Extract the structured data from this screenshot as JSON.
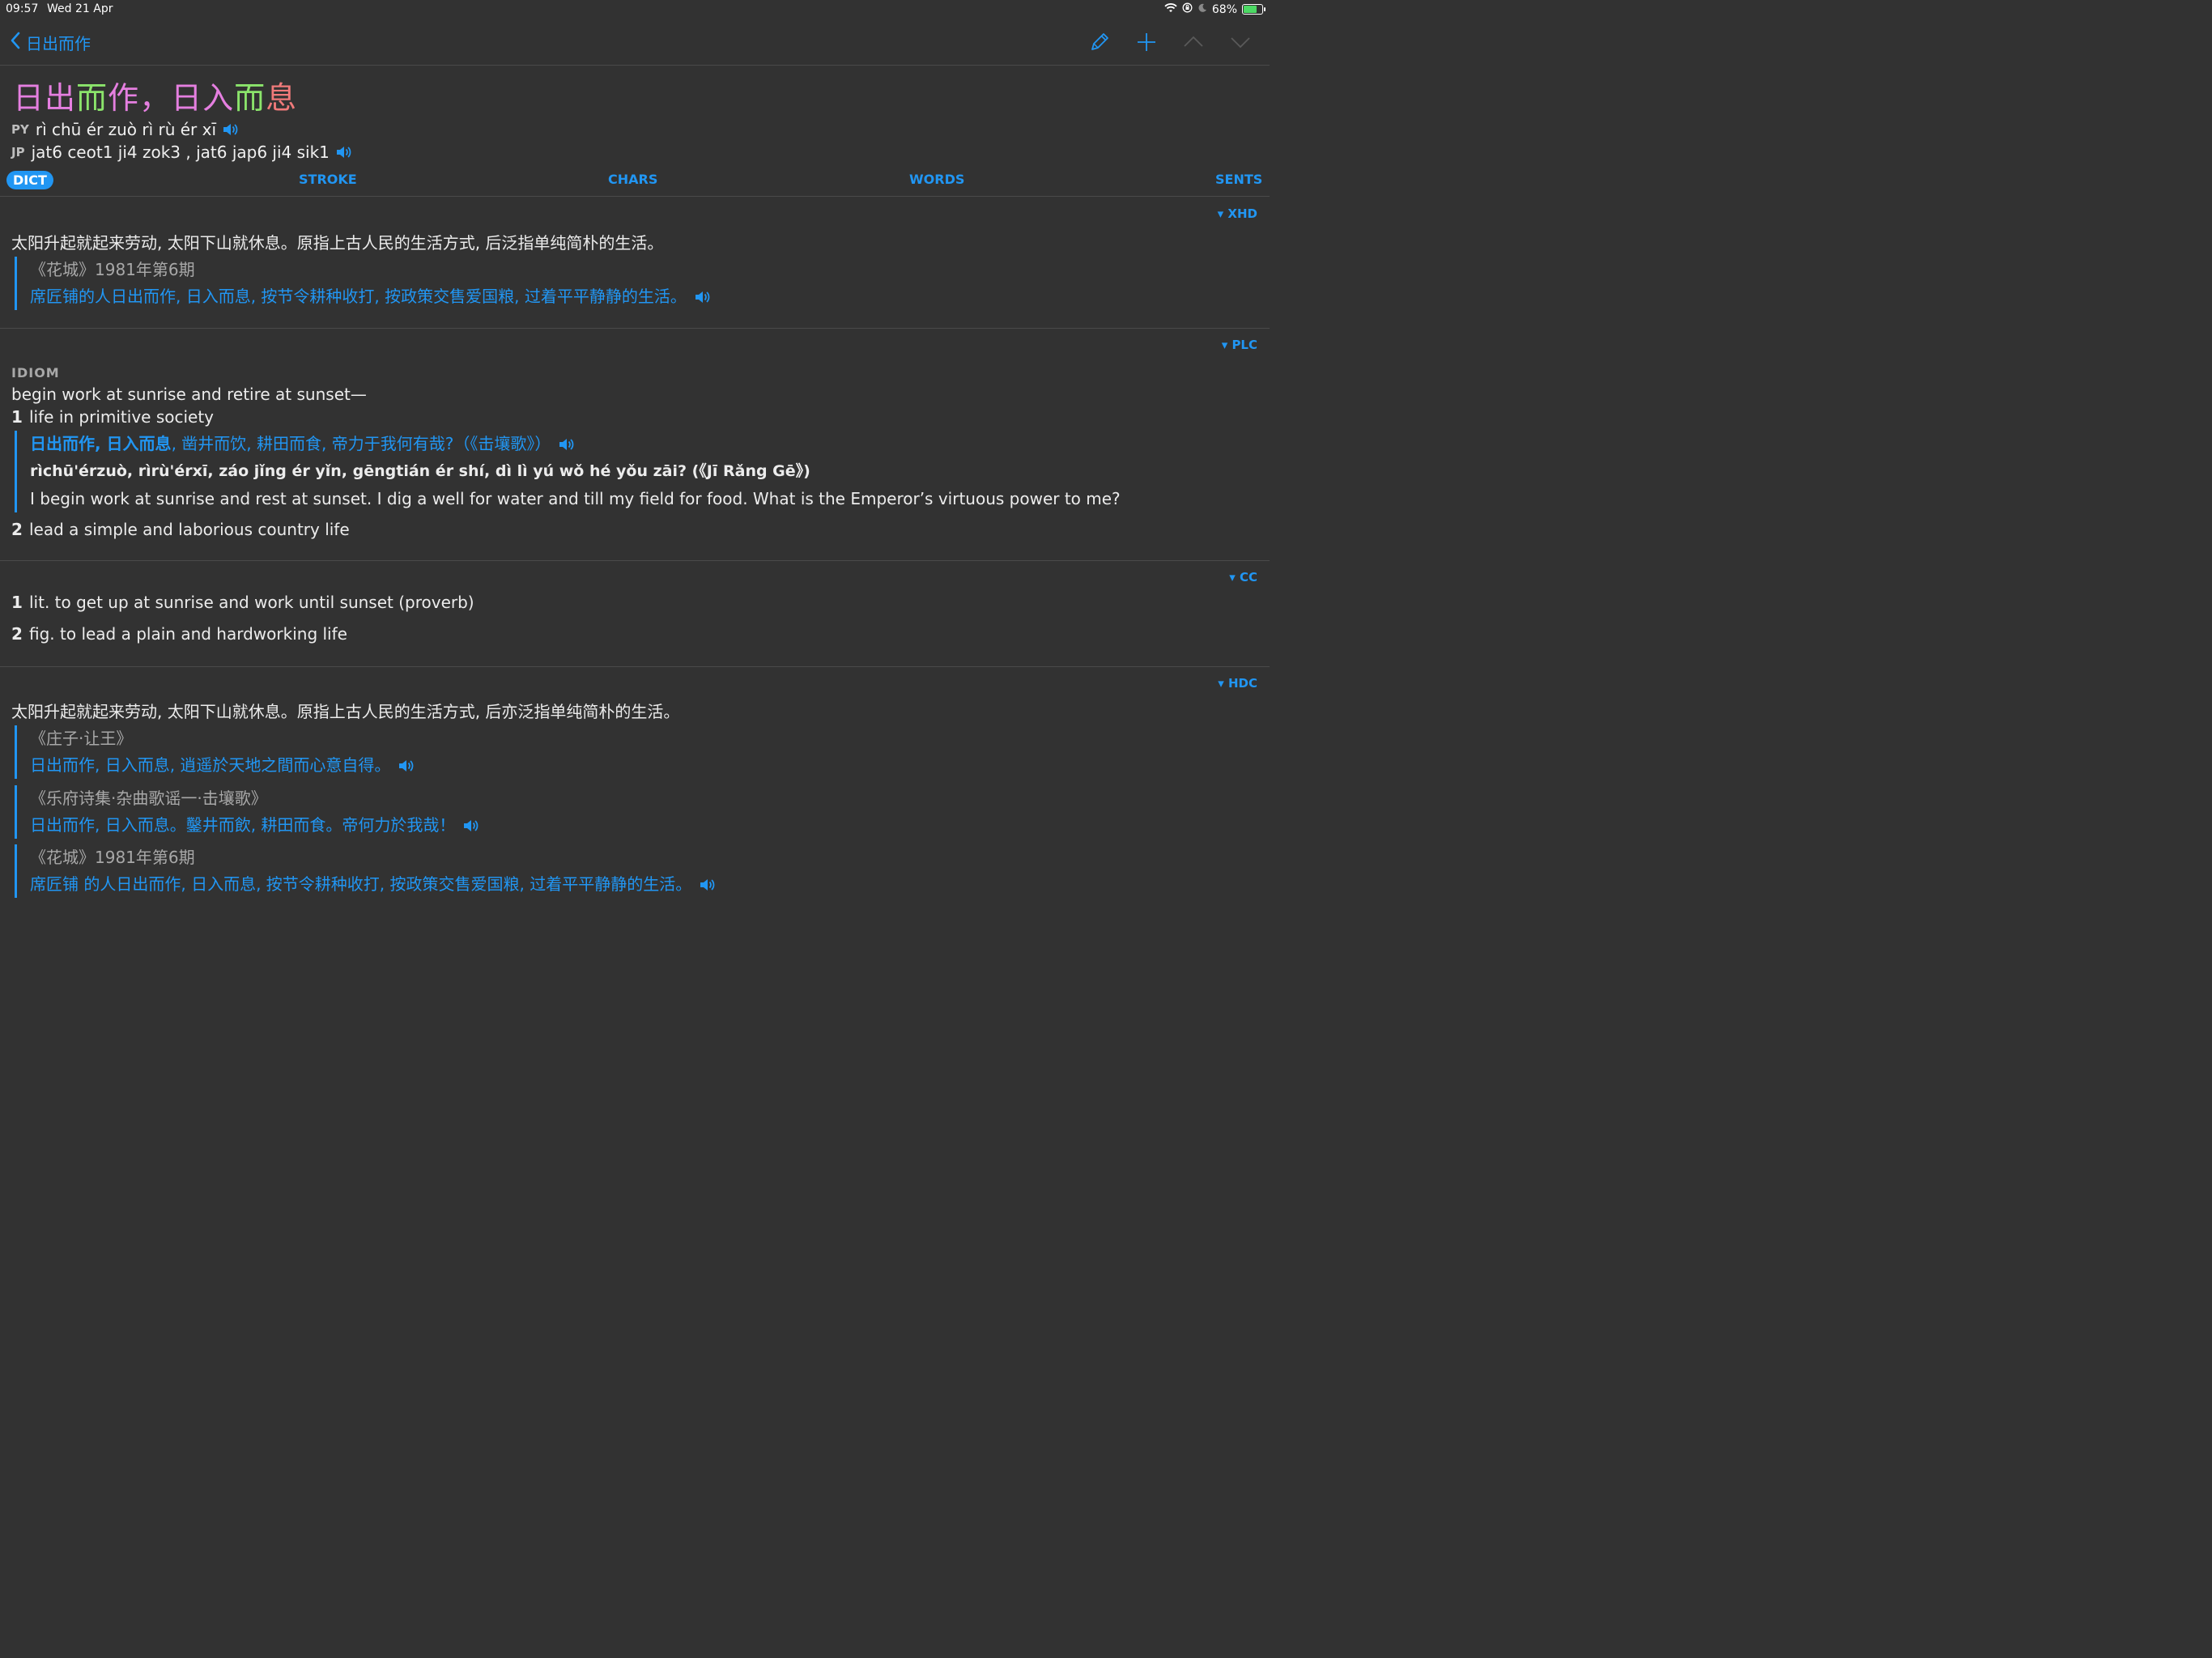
{
  "status": {
    "time": "09:57",
    "date": "Wed 21 Apr",
    "battery": "68%",
    "battery_level": 0.68
  },
  "nav": {
    "back_label": "日出而作"
  },
  "headword": {
    "chars": [
      {
        "c": "日",
        "color": "#e57fe0"
      },
      {
        "c": "出",
        "color": "#e57fe0"
      },
      {
        "c": "而",
        "color": "#8be46b"
      },
      {
        "c": "作",
        "color": "#e57fe0"
      },
      {
        "c": "，",
        "color": "#e57fe0"
      },
      {
        "c": "日",
        "color": "#e57fe0"
      },
      {
        "c": "入",
        "color": "#e57fe0"
      },
      {
        "c": "而",
        "color": "#8be46b"
      },
      {
        "c": "息",
        "color": "#f07a7a"
      }
    ]
  },
  "pron": {
    "py_tag": "PY",
    "py": "rì chū ér zuò rì rù   ér xī",
    "jp_tag": "JP",
    "jp": "jat6 ceot1 ji4 zok3 , jat6 jap6 ji4 sik1"
  },
  "tabs": [
    "DICT",
    "STROKE",
    "CHARS",
    "WORDS",
    "SENTS"
  ],
  "xhd": {
    "source": "▾ XHD",
    "definition": "太阳升起就起来劳动, 太阳下山就休息。原指上古人民的生活方式, 后泛指单纯简朴的生活。",
    "quote_source": "《花城》1981年第6期",
    "quote_text": "席匠铺的人日出而作, 日入而息, 按节令耕种收打, 按政策交售爱国粮, 过着平平静静的生活。"
  },
  "plc": {
    "source": "▾ PLC",
    "label": "IDIOM",
    "gloss": "begin work at sunrise and retire at sunset—",
    "sense1_num": "1",
    "sense1": "life in primitive society",
    "ex_bold": "日出而作, 日入而息",
    "ex_rest": ", 凿井而饮, 耕田而食, 帝力于我何有哉?（《击壤歌》）",
    "ex_pinyin": "rìchū'érzuò,  rìrù'érxī,  záo jǐng ér yǐn,  gēngtián ér shí, dì lì yú wǒ hé yǒu zāi?  (《Jī Rǎng Gē》)",
    "ex_english": "I begin work at sunrise and rest at sunset. I dig a well for water and till my field for food. What is the Emperor’s virtuous power to me?",
    "sense2_num": "2",
    "sense2": "lead a simple and laborious country life"
  },
  "cc": {
    "source": "▾ CC",
    "sense1_num": "1",
    "sense1": "lit. to get up at sunrise and work until sunset (proverb)",
    "sense2_num": "2",
    "sense2": "fig. to lead a plain and hardworking life"
  },
  "hdc": {
    "source": "▾ HDC",
    "definition": "太阳升起就起来劳动, 太阳下山就休息。原指上古人民的生活方式, 后亦泛指单纯简朴的生活。",
    "quotes": [
      {
        "source": "《庄子·让王》",
        "text": "日出而作, 日入而息, 逍遥於天地之間而心意自得。"
      },
      {
        "source": "《乐府诗集·杂曲歌谣一·击壤歌》",
        "text": "日出而作, 日入而息。鑿井而飲, 耕田而食。帝何力於我哉！"
      },
      {
        "source": "《花城》1981年第6期",
        "text": "席匠铺 的人日出而作, 日入而息, 按节令耕种收打, 按政策交售爱国粮, 过着平平静静的生活。"
      }
    ]
  }
}
